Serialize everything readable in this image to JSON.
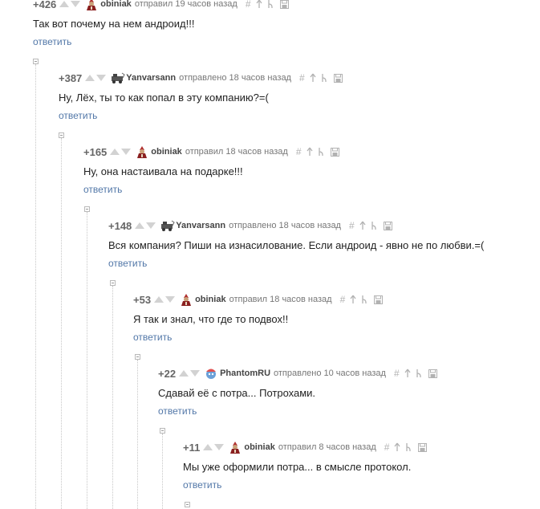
{
  "reply_label": "ответить",
  "comments": [
    {
      "rating": "+426",
      "user": "obiniak",
      "sent": "отправил 19 часов назад",
      "text": "Так вот почему на нем андроид!!!",
      "avatar": "obiniak-avatar"
    },
    {
      "rating": "+387",
      "user": "Yanvarsann",
      "sent": "отправлено 18 часов назад",
      "text": "Ну, Лёх, ты то как попал в эту компанию?=(",
      "avatar": "yanvarsann-avatar"
    },
    {
      "rating": "+165",
      "user": "obiniak",
      "sent": "отправил 18 часов назад",
      "text": "Ну, она настаивала на подарке!!!",
      "avatar": "obiniak-avatar"
    },
    {
      "rating": "+148",
      "user": "Yanvarsann",
      "sent": "отправлено 18 часов назад",
      "text": "Вся компания? Пиши на изнасилование. Если андроид - явно не по любви.=(",
      "avatar": "yanvarsann-avatar"
    },
    {
      "rating": "+53",
      "user": "obiniak",
      "sent": "отправил 18 часов назад",
      "text": "Я так и знал, что где то подвох!!",
      "avatar": "obiniak-avatar"
    },
    {
      "rating": "+22",
      "user": "PhantomRU",
      "sent": "отправлено 10 часов назад",
      "text": "Сдавай её с потра... Потрохами.",
      "avatar": "phantomru-avatar"
    },
    {
      "rating": "+11",
      "user": "obiniak",
      "sent": "отправил 8 часов назад",
      "text": "Мы уже оформили потра... в смысле протокол.",
      "avatar": "obiniak-avatar"
    }
  ],
  "tool_icons": [
    "hash-icon",
    "parent-arrow-icon",
    "branch-icon",
    "save-icon"
  ],
  "colors": {
    "link": "#5277a8",
    "rating": "#666666",
    "vote_arrow": "#d2d2d2",
    "thread_line": "#c7c7c7"
  }
}
